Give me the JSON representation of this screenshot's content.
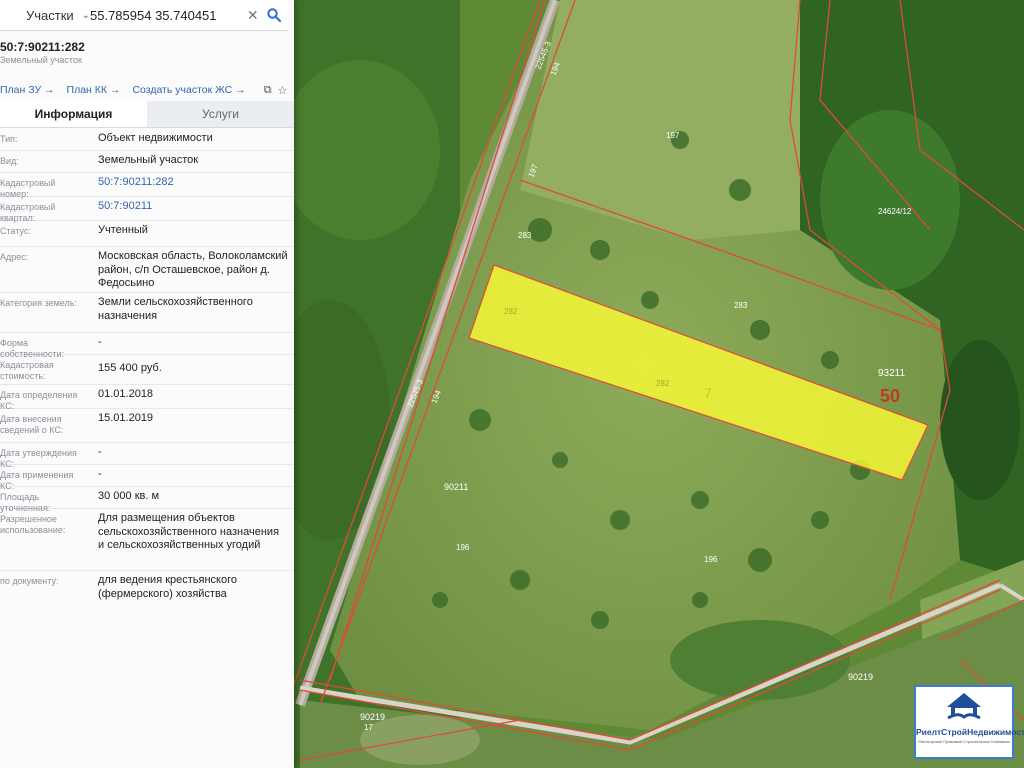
{
  "search": {
    "type_label": "Участки",
    "query": "55.785954 35.740451"
  },
  "parcel": {
    "cadastral_title": "50:7:90211:282",
    "subtitle": "Земельный участок"
  },
  "links": [
    {
      "label": "План ЗУ →"
    },
    {
      "label": "План КК →"
    },
    {
      "label": "Создать участок ЖС →"
    }
  ],
  "tabs": [
    {
      "label": "Информация",
      "active": true
    },
    {
      "label": "Услуги",
      "active": false
    }
  ],
  "info": [
    {
      "key": "Тип:",
      "value": "Объект недвижимости"
    },
    {
      "key": "Вид:",
      "value": "Земельный участок"
    },
    {
      "key": "Кадастровый номер:",
      "value": "50:7:90211:282",
      "link": true
    },
    {
      "key": "Кадастровый квартал:",
      "value": "50:7:90211",
      "link": true
    },
    {
      "key": "Статус:",
      "value": "Учтенный"
    },
    {
      "key": "Адрес:",
      "value": "Московская область, Волоколамский район, с/п Осташевское, район д. Федосьино"
    },
    {
      "key": "Категория земель:",
      "value": "Земли сельскохозяйственного назначения"
    },
    {
      "key": "Форма собственности:",
      "value": "-"
    },
    {
      "key": "Кадастровая стоимость:",
      "value": "155 400 руб."
    },
    {
      "key": "Дата определения КС:",
      "value": "01.01.2018"
    },
    {
      "key": "Дата внесения сведений о КС:",
      "value": "15.01.2019"
    },
    {
      "key": "Дата утверждения КС:",
      "value": "-"
    },
    {
      "key": "Дата применения КС:",
      "value": "-"
    },
    {
      "key": "Площадь уточненная:",
      "value": "30 000 кв. м"
    },
    {
      "key": "Разрешенное использование:",
      "value": "Для размещения объектов сельскохозяйственного назначения и сельскохозяйственных угодий"
    },
    {
      "key": "по документу:",
      "value": "для ведения крестьянского (фермерского) хозяйства"
    }
  ],
  "map_labels": {
    "road_a": "22545-3",
    "road_b": "194",
    "p197": "197",
    "p197b": "197",
    "p283": "283",
    "p283b": "283",
    "p282": "282",
    "p282b": "282",
    "p7": "7",
    "p24624": "24624/12",
    "q93211": "93211",
    "n50": "50",
    "road_c": "22545-3",
    "road_d": "194",
    "q90211": "90211",
    "p196": "196",
    "p196b": "196",
    "q90219": "90219",
    "q90219b": "90219",
    "p17": "17"
  },
  "logo": {
    "title": "РиелтСтройНедвижимость",
    "subtitle": "Риелторские Правовые Строительные Компании"
  },
  "colors": {
    "parcel_highlight": "#ffff33",
    "boundary": "#e04a3a",
    "link": "#3366aa",
    "search_icon": "#2a6fd1"
  }
}
